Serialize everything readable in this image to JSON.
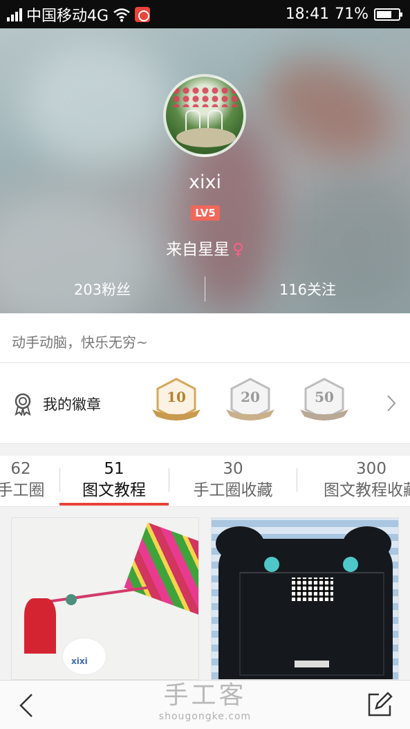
{
  "status_bar": {
    "carrier": "中国移动4G",
    "time": "18:41",
    "battery_percent": "71%",
    "battery_level": 0.71
  },
  "profile": {
    "username": "xixi",
    "level": "LV5",
    "location": "来自星星",
    "gender_symbol": "♀",
    "fans": "203粉丝",
    "following": "116关注",
    "bio": "动手动脑，快乐无穷~"
  },
  "badges": {
    "label": "我的徽章",
    "items": [
      "10",
      "20",
      "50"
    ]
  },
  "tabs": [
    {
      "count": "62",
      "label": "手工圈"
    },
    {
      "count": "51",
      "label": "图文教程"
    },
    {
      "count": "30",
      "label": "手工圈收藏"
    },
    {
      "count": "300",
      "label": "图文教程收藏"
    }
  ],
  "active_tab": 1,
  "cards": [
    {
      "label": "xixi"
    }
  ],
  "footer": {
    "brand": "手工客",
    "url": "shougongke.com"
  },
  "colors": {
    "accent": "#e8413a",
    "status_bar": "#0d0d0d",
    "gender": "#ff5f86",
    "level_badge": "#f0685a"
  }
}
